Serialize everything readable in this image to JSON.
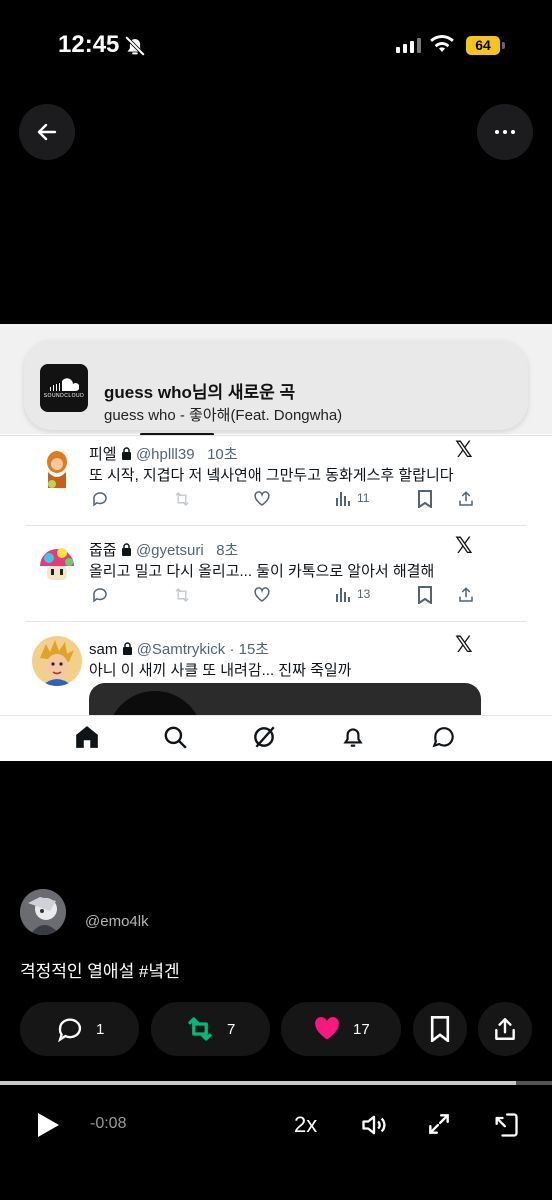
{
  "status_bar": {
    "time": "12:45",
    "battery": "64"
  },
  "notification": {
    "title": "guess who님의 새로운 곡",
    "subtitle": "guess who - 좋아해(Feat. Dongwha)",
    "app_logo_text": "SOUNDCLOUD"
  },
  "tweets": [
    {
      "name": "피엘",
      "handle": "@hplll39",
      "time": "10초",
      "text": "또 시작, 지겹다 저 녴사연애 그만두고 동화게스후 할랍니다",
      "views": "11"
    },
    {
      "name": "줍줍",
      "handle": "@gyetsuri",
      "time": "8초",
      "text": "올리고 밀고 다시 올리고... 둘이 카톡으로 알아서 해결해",
      "views": "13"
    },
    {
      "name": "sam",
      "handle": "@Samtrykick",
      "time": "· 15초",
      "text": "아니 이 새끼 사클 또 내려감... 진짜 죽일까"
    }
  ],
  "post": {
    "username": "@emo4lk",
    "caption": "격정적인 열애설 #녘겐",
    "comments": "1",
    "reposts": "7",
    "likes": "17"
  },
  "player": {
    "time_remaining": "-0:08",
    "speed": "2x",
    "progress": 0.935
  },
  "colors": {
    "repost": "#00ba7c",
    "like": "#f91880",
    "battery": "#f5c518"
  }
}
